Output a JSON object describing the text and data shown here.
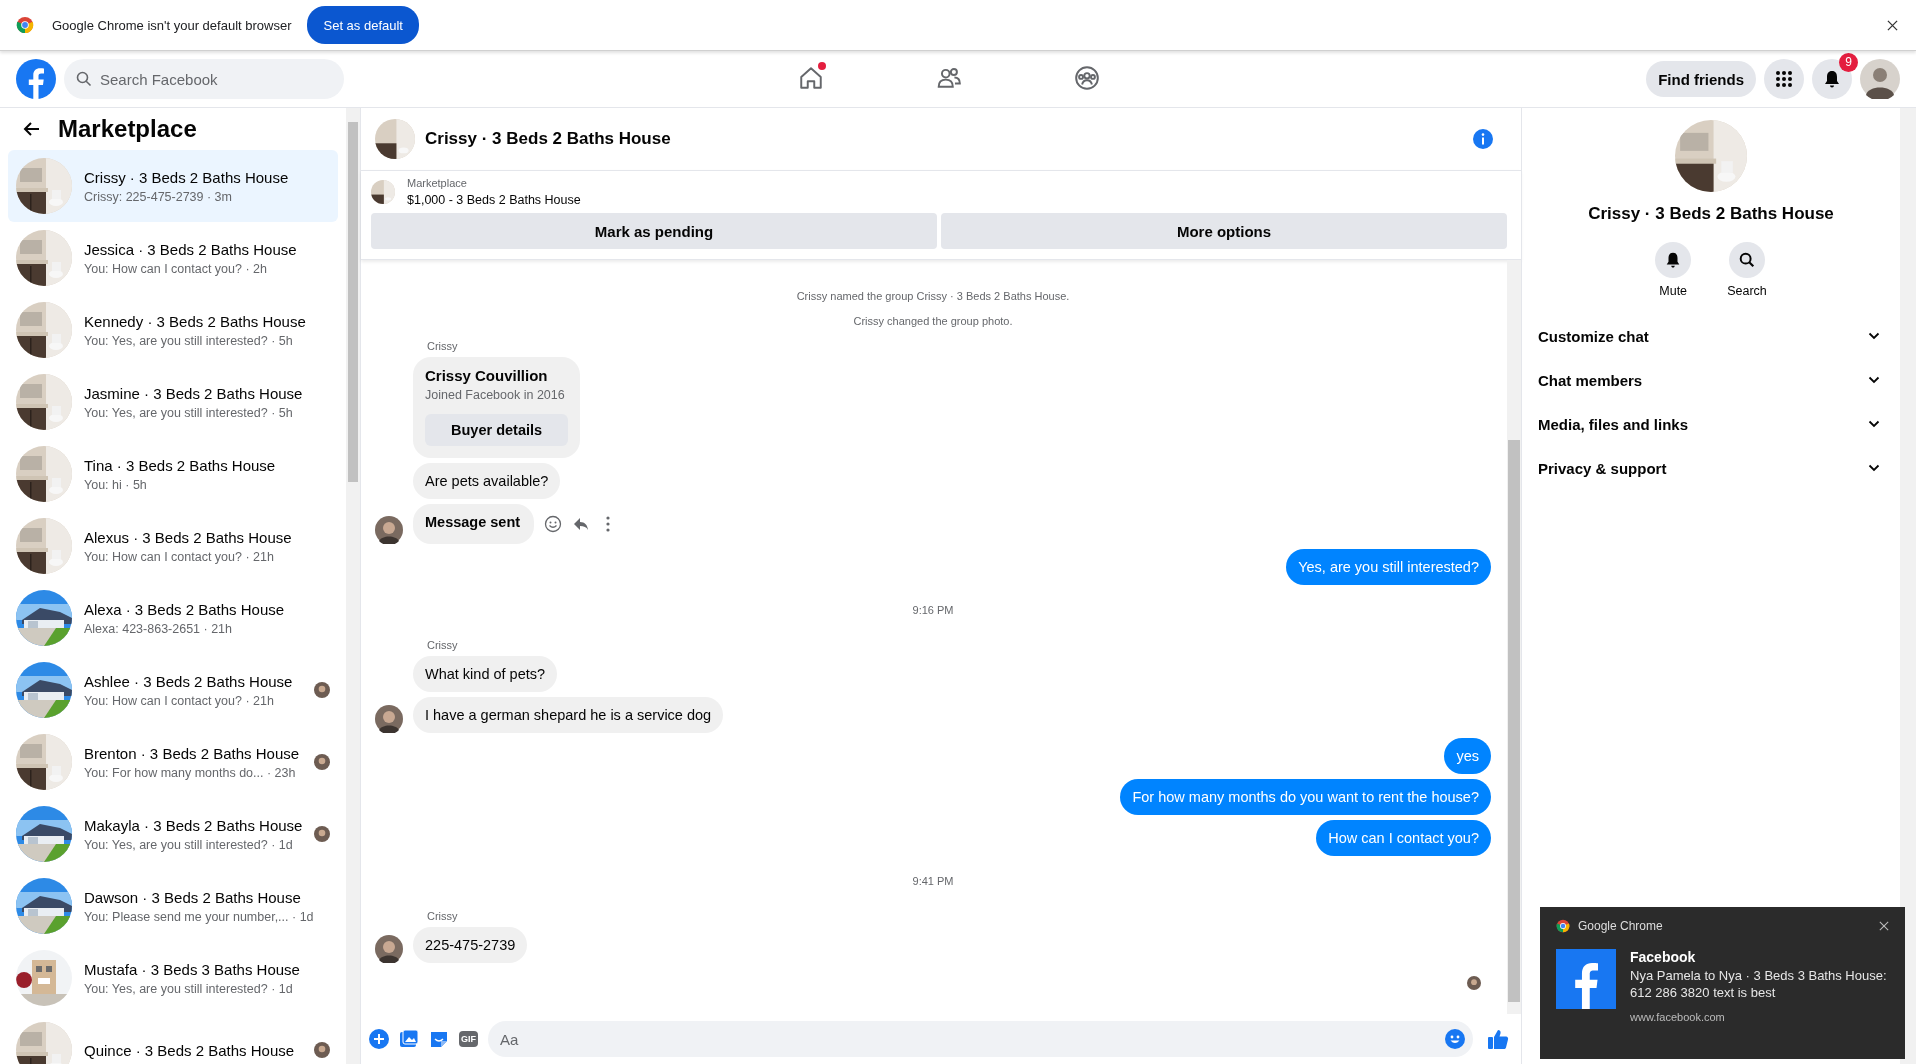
{
  "infobar": {
    "message": "Google Chrome isn't your default browser",
    "button": "Set as default"
  },
  "nav": {
    "search_placeholder": "Search Facebook",
    "tabs": [
      {
        "kind": "home",
        "selected": false,
        "dot": true
      },
      {
        "kind": "friends",
        "selected": false,
        "dot": false
      },
      {
        "kind": "groups",
        "selected": false,
        "dot": false
      }
    ],
    "find_friends": "Find friends",
    "notification_count": "9"
  },
  "sidebar": {
    "title": "Marketplace",
    "items": [
      {
        "name": "Crissy · 3 Beds 2 Baths House",
        "preview": "Crissy: 225-475-2739 · 3m",
        "selected": true,
        "seen": false
      },
      {
        "name": "Jessica · 3 Beds 2 Baths House",
        "preview": "You: How can I contact you? · 2h",
        "selected": false,
        "seen": false
      },
      {
        "name": "Kennedy · 3 Beds 2 Baths House",
        "preview": "You: Yes, are you still interested? · 5h",
        "selected": false,
        "seen": false
      },
      {
        "name": "Jasmine · 3 Beds 2 Baths House",
        "preview": "You: Yes, are you still interested? · 5h",
        "selected": false,
        "seen": false
      },
      {
        "name": "Tina · 3 Beds 2 Baths House",
        "preview": "You: hi · 5h",
        "selected": false,
        "seen": false
      },
      {
        "name": "Alexus · 3 Beds 2 Baths House",
        "preview": "You: How can I contact you? · 21h",
        "selected": false,
        "seen": false
      },
      {
        "name": "Alexa · 3 Beds 2 Baths House",
        "preview": "Alexa: 423-863-2651 · 21h",
        "selected": false,
        "seen": false
      },
      {
        "name": "Ashlee · 3 Beds 2 Baths House",
        "preview": "You: How can I contact you? · 21h",
        "selected": false,
        "seen": true
      },
      {
        "name": "Brenton · 3 Beds 2 Baths House",
        "preview": "You: For how many months do... · 23h",
        "selected": false,
        "seen": true
      },
      {
        "name": "Makayla · 3 Beds 2 Baths House",
        "preview": "You: Yes, are you still interested? · 1d",
        "selected": false,
        "seen": true
      },
      {
        "name": "Dawson · 3 Beds 2 Baths House",
        "preview": "You: Please send me your number,... · 1d",
        "selected": false,
        "seen": false
      },
      {
        "name": "Mustafa · 3 Beds 3 Baths House",
        "preview": "You: Yes, are you still interested? · 1d",
        "selected": false,
        "seen": false
      },
      {
        "name": "Quince · 3 Beds 2 Baths House",
        "selected": false,
        "seen": true
      }
    ]
  },
  "chat": {
    "title": "Crissy · 3 Beds 2 Baths House",
    "listing": {
      "label": "Marketplace",
      "title": "$1,000 - 3 Beds 2 Baths House"
    },
    "actions": [
      "Mark as pending",
      "More options"
    ],
    "messages": [
      {
        "kind": "system",
        "text": "Crissy named the group Crissy · 3 Beds 2 Baths House."
      },
      {
        "kind": "system",
        "text": "Crissy changed the group photo."
      },
      {
        "kind": "sender",
        "text": "Crissy"
      },
      {
        "kind": "card",
        "name": "Crissy Couvillion",
        "detail": "Joined Facebook in 2016",
        "button": "Buyer details"
      },
      {
        "kind": "incoming",
        "text": "Are pets available?",
        "avatar": false,
        "hovered": false,
        "bold": false
      },
      {
        "kind": "incoming",
        "text": "Message sent",
        "avatar": true,
        "hovered": true,
        "bold": true
      },
      {
        "kind": "outgoing",
        "text": "Yes, are you still interested?"
      },
      {
        "kind": "time",
        "text": "9:16 PM"
      },
      {
        "kind": "sender",
        "text": "Crissy"
      },
      {
        "kind": "incoming",
        "text": "What kind of pets?",
        "avatar": false,
        "hovered": false,
        "bold": false
      },
      {
        "kind": "incoming",
        "text": "I have a german shepard he is a service dog",
        "avatar": true,
        "hovered": false,
        "bold": false
      },
      {
        "kind": "outgoing",
        "text": "yes"
      },
      {
        "kind": "outgoing",
        "text": "For how many months do you want to rent the house?"
      },
      {
        "kind": "outgoing",
        "text": "How can I contact you?"
      },
      {
        "kind": "time",
        "text": "9:41 PM"
      },
      {
        "kind": "sender",
        "text": "Crissy"
      },
      {
        "kind": "incoming",
        "text": "225-475-2739",
        "avatar": true,
        "hovered": false,
        "bold": false
      }
    ],
    "seen": true,
    "composer": {
      "gif_label": "GIF",
      "placeholder": "Aa"
    }
  },
  "details": {
    "title": "Crissy · 3 Beds 2 Baths House",
    "buttons": [
      "Mute",
      "Search"
    ],
    "sections": [
      {
        "label": "Customize chat",
        "expanded": false
      },
      {
        "label": "Chat members",
        "expanded": false
      },
      {
        "label": "Media, files and links",
        "expanded": false
      },
      {
        "label": "Privacy & support",
        "expanded": false
      }
    ]
  },
  "notification": {
    "app": "Google Chrome",
    "title": "Facebook",
    "body": "Nya Pamela to Nya · 3 Beds 3 Baths House: 612 286 3820 text is best",
    "source": "www.facebook.com"
  }
}
